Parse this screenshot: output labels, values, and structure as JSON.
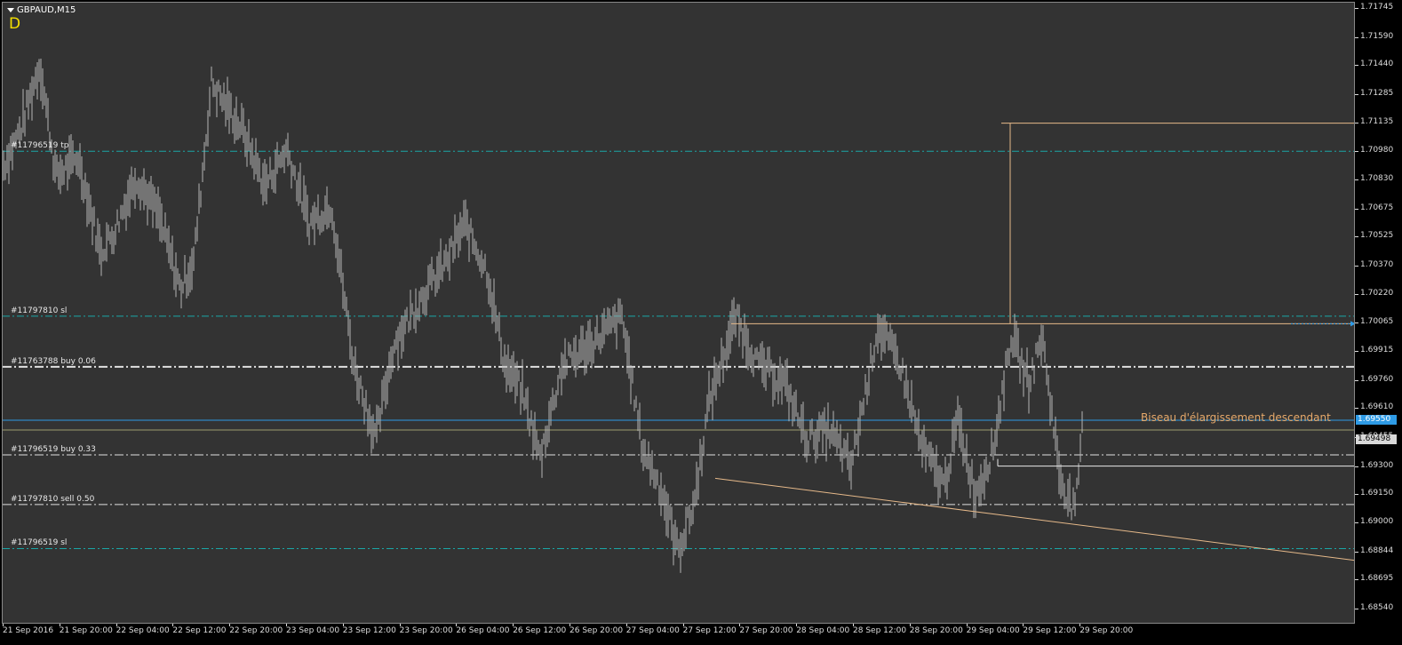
{
  "window": {
    "title": "GBPAUD,M15",
    "ea_badge": "D"
  },
  "colors": {
    "background": "#333333",
    "candles": "#b4b4b4",
    "stop_level": "#1aa6a6",
    "order_line": "#e0e0e0",
    "pattern": "#e6b98a",
    "bid_line": "#2e9be6",
    "ask_line": "#9b9b6e",
    "annotation": "#e6a96b"
  },
  "order_labels": [
    {
      "id": "tp1",
      "text": "#11796519 tp",
      "price": 1.70985
    },
    {
      "id": "sl1",
      "text": "#11797810 sl",
      "price": 1.70105
    },
    {
      "id": "buy1",
      "text": "#11763788 buy 0.06",
      "price": 1.69835
    },
    {
      "id": "buy2",
      "text": "#11796519 buy 0.33",
      "price": 1.69365
    },
    {
      "id": "sell1",
      "text": "#11797810 sell 0.50",
      "price": 1.691
    },
    {
      "id": "sl2",
      "text": "#11796519 sl",
      "price": 1.68865
    }
  ],
  "annotation": "Biseau d'élargissement descendant",
  "price_axis": {
    "min": 1.6854,
    "max": 1.71745,
    "ticks": [
      "1.71745",
      "1.71590",
      "1.71440",
      "1.71285",
      "1.71135",
      "1.70980",
      "1.70830",
      "1.70675",
      "1.70525",
      "1.70370",
      "1.70220",
      "1.70065",
      "1.69915",
      "1.69760",
      "1.69610",
      "1.69455",
      "1.69300",
      "1.69150",
      "1.69000",
      "1.68844",
      "1.68695",
      "1.68540"
    ],
    "bid_marker": {
      "text": "1.69550",
      "price": 1.6955
    },
    "ask_marker": {
      "text": "1.69498",
      "price": 1.69498
    }
  },
  "time_axis": {
    "labels": [
      "21 Sep 2016",
      "21 Sep 20:00",
      "22 Sep 04:00",
      "22 Sep 12:00",
      "22 Sep 20:00",
      "23 Sep 04:00",
      "23 Sep 12:00",
      "23 Sep 20:00",
      "26 Sep 04:00",
      "26 Sep 12:00",
      "26 Sep 20:00",
      "27 Sep 04:00",
      "27 Sep 12:00",
      "27 Sep 20:00",
      "28 Sep 04:00",
      "28 Sep 12:00",
      "28 Sep 20:00",
      "29 Sep 04:00",
      "29 Sep 12:00",
      "29 Sep 20:00"
    ]
  },
  "chart_data": {
    "type": "candlestick",
    "symbol": "GBPAUD",
    "timeframe": "M15",
    "ylim": [
      1.6854,
      1.71745
    ],
    "horizontal_levels": [
      {
        "name": "#11796519 tp",
        "price": 1.70985,
        "style": "stop"
      },
      {
        "name": "#11797810 sl",
        "price": 1.70105,
        "style": "stop"
      },
      {
        "name": "#11763788 buy 0.06",
        "price": 1.69835,
        "style": "order"
      },
      {
        "name": "#11796519 buy 0.33",
        "price": 1.69365,
        "style": "order"
      },
      {
        "name": "#11797810 sell 0.50",
        "price": 1.691,
        "style": "order"
      },
      {
        "name": "#11796519 sl",
        "price": 1.68865,
        "style": "stop"
      },
      {
        "name": "bid",
        "price": 1.6955,
        "style": "bid"
      },
      {
        "name": "ask",
        "price": 1.69498,
        "style": "ask"
      }
    ],
    "price_path": [
      [
        0,
        1.709
      ],
      [
        20,
        1.711
      ],
      [
        42,
        1.7145
      ],
      [
        60,
        1.7085
      ],
      [
        85,
        1.7095
      ],
      [
        110,
        1.7045
      ],
      [
        125,
        1.7055
      ],
      [
        150,
        1.7085
      ],
      [
        175,
        1.7065
      ],
      [
        200,
        1.7025
      ],
      [
        215,
        1.704
      ],
      [
        235,
        1.7135
      ],
      [
        270,
        1.711
      ],
      [
        295,
        1.708
      ],
      [
        320,
        1.71
      ],
      [
        345,
        1.706
      ],
      [
        370,
        1.707
      ],
      [
        395,
        1.6985
      ],
      [
        420,
        1.6945
      ],
      [
        440,
        1.6995
      ],
      [
        470,
        1.702
      ],
      [
        500,
        1.704
      ],
      [
        520,
        1.706
      ],
      [
        545,
        1.7035
      ],
      [
        565,
        1.6985
      ],
      [
        585,
        1.697
      ],
      [
        605,
        1.6935
      ],
      [
        630,
        1.6985
      ],
      [
        660,
        1.6995
      ],
      [
        697,
        1.701
      ],
      [
        720,
        1.694
      ],
      [
        740,
        1.692
      ],
      [
        760,
        1.6885
      ],
      [
        778,
        1.691
      ],
      [
        795,
        1.6965
      ],
      [
        825,
        1.701
      ],
      [
        850,
        1.6985
      ],
      [
        880,
        1.6975
      ],
      [
        905,
        1.6945
      ],
      [
        930,
        1.695
      ],
      [
        955,
        1.693
      ],
      [
        985,
        1.7005
      ],
      [
        1010,
        1.6985
      ],
      [
        1035,
        1.694
      ],
      [
        1060,
        1.692
      ],
      [
        1075,
        1.6955
      ],
      [
        1095,
        1.6915
      ],
      [
        1115,
        1.694
      ],
      [
        1135,
        1.7
      ],
      [
        1155,
        1.6975
      ],
      [
        1170,
        1.7
      ],
      [
        1190,
        1.6925
      ],
      [
        1207,
        1.6905
      ],
      [
        1216,
        1.6955
      ]
    ],
    "pattern": {
      "name": "Biseau d'élargissement descendant",
      "upper_line": {
        "x": [
          820,
          1525
        ],
        "price": [
          1.70065,
          1.70065
        ]
      },
      "lower_line": {
        "x": [
          802,
          1525
        ],
        "price": [
          1.6924,
          1.688
        ]
      },
      "measured_move": {
        "x": 1134,
        "from": 1.70065,
        "to": 1.71135,
        "end_x": 1525
      },
      "breakout_box": {
        "x": [
          1120,
          1525
        ],
        "price": [
          1.69305,
          1.69305
        ]
      }
    }
  }
}
